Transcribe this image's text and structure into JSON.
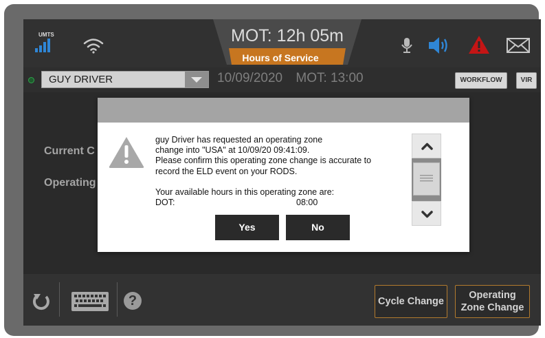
{
  "status": {
    "network_label": "UMTS",
    "mot_time": "MOT: 12h 05m",
    "hos_label": "Hours of Service",
    "accent_color": "#c77620",
    "alert_color": "#c41515",
    "signal_color": "#2f86d6"
  },
  "driver": {
    "name": "GUY DRIVER",
    "date": "10/09/2020",
    "mot": "MOT: 13:00",
    "workflow_label": "WORKFLOW",
    "vir_label": "VIR"
  },
  "background": {
    "label1": "Current C",
    "label2": "Operating"
  },
  "dialog": {
    "line1": "guy Driver has requested an operating zone",
    "line2": "change into \"USA\" at 10/09/20 09:41:09.",
    "line3": "Please confirm this operating zone change is accurate to",
    "line4": "record the ELD event on your RODS.",
    "line5": "Your available hours in this operating zone are:",
    "dot_label": "DOT:",
    "dot_value": "08:00",
    "yes_label": "Yes",
    "no_label": "No"
  },
  "bottom": {
    "help_label": "?",
    "cycle_change": "Cycle Change",
    "zone_change_line1": "Operating",
    "zone_change_line2": "Zone Change"
  },
  "icons": [
    "signal-icon",
    "wifi-icon",
    "mic-icon",
    "speaker-icon",
    "alert-icon",
    "mail-icon",
    "warning-icon",
    "refresh-icon",
    "keyboard-icon",
    "help-icon",
    "chevron-up-icon",
    "chevron-down-icon"
  ]
}
